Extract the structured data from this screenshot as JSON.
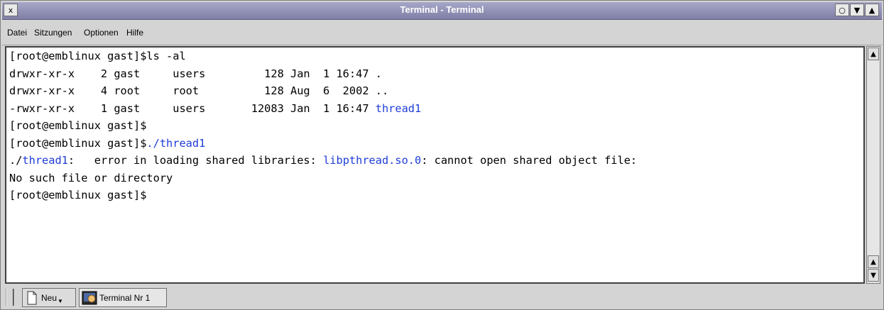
{
  "window": {
    "title": "Terminal - Terminal",
    "close_button_glyph": "x",
    "circle_button_glyph": "○",
    "shade_button_glyph": "▼",
    "maximize_button_glyph": "▲"
  },
  "menubar": {
    "items": [
      "Datei",
      "Sitzungen",
      "Optionen",
      "Hilfe"
    ]
  },
  "terminal": {
    "lines": [
      [
        {
          "text": "[root@emblinux gast]$ls -al"
        }
      ],
      [
        {
          "text": "drwxr-xr-x    2 gast     users         128 Jan  1 16:47 ."
        }
      ],
      [
        {
          "text": "drwxr-xr-x    4 root     root          128 Aug  6  2002 .."
        }
      ],
      [
        {
          "text": "-rwxr-xr-x    1 gast     users       12083 Jan  1 16:47 "
        },
        {
          "text": "thread1",
          "color": "blue"
        }
      ],
      [
        {
          "text": "[root@emblinux gast]$"
        }
      ],
      [
        {
          "text": "[root@emblinux gast]$"
        },
        {
          "text": "./thread1",
          "color": "blue"
        }
      ],
      [
        {
          "text": "./"
        },
        {
          "text": "thread1",
          "color": "blue"
        },
        {
          "text": ":   error in loading shared libraries: "
        },
        {
          "text": "libpthread.so.0",
          "color": "blue"
        },
        {
          "text": ": cannot open shared object file:"
        }
      ],
      [
        {
          "text": "No such file or directory"
        }
      ],
      [
        {
          "text": "[root@emblinux gast]$"
        }
      ]
    ]
  },
  "tabbar": {
    "new_label": "Neu",
    "session_tab_label": "Terminal Nr 1"
  },
  "colors": {
    "highlight_blue": "#1f3dd6",
    "title_bar": "#8f8fb6"
  }
}
